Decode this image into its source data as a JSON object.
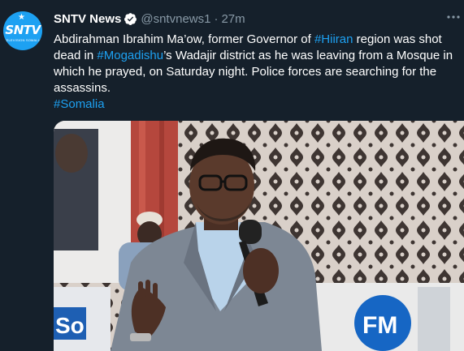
{
  "tweet": {
    "display_name": "SNTV News",
    "handle": "@sntvnews1",
    "separator": "·",
    "time": "27m",
    "text_parts": [
      "Abdirahman Ibrahim Ma’ow, former Governor of ",
      "#Hiiran",
      " region was shot dead in ",
      "#Mogadishu",
      "’s Wadajir district as he was leaving from a Mosque in which he prayed, on Saturday night. Police forces are searching for the assassins."
    ],
    "hashtag_line": "#Somalia"
  },
  "avatar": {
    "logo_text": "SNTV",
    "logo_sub": "TELEVISION SOMALIA"
  },
  "media": {
    "banner_text": "FM",
    "left_banner_text": "So"
  },
  "colors": {
    "background": "#15202b",
    "link": "#1da1f2",
    "secondary_text": "#8899a6",
    "avatar_bg": "#1da1f2"
  },
  "icons": {
    "verified": "verified-badge-icon",
    "more": "more-options-icon"
  }
}
